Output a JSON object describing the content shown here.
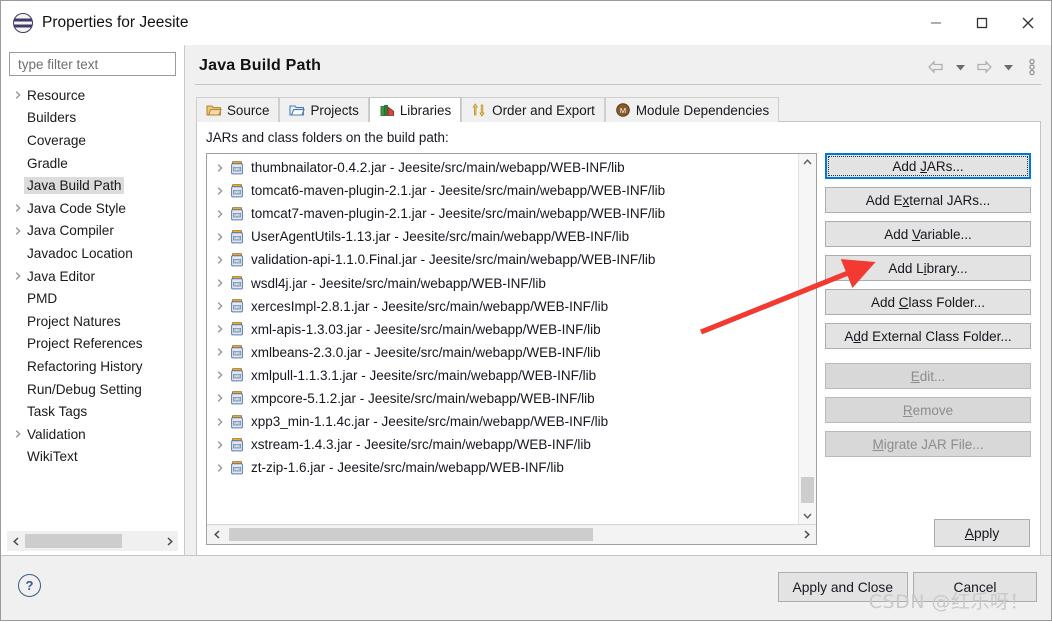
{
  "window": {
    "title": "Properties for Jeesite",
    "icon": "eclipse-icon",
    "controls": {
      "minimize": "minimize-icon",
      "maximize": "maximize-icon",
      "close": "close-icon"
    }
  },
  "sidebar": {
    "filter": {
      "placeholder": "type filter text",
      "value": ""
    },
    "items": [
      {
        "label": "Resource",
        "expandable": true,
        "selected": false
      },
      {
        "label": "Builders",
        "expandable": false,
        "selected": false
      },
      {
        "label": "Coverage",
        "expandable": false,
        "selected": false
      },
      {
        "label": "Gradle",
        "expandable": false,
        "selected": false
      },
      {
        "label": "Java Build Path",
        "expandable": false,
        "selected": true
      },
      {
        "label": "Java Code Style",
        "expandable": true,
        "selected": false
      },
      {
        "label": "Java Compiler",
        "expandable": true,
        "selected": false
      },
      {
        "label": "Javadoc Location",
        "expandable": false,
        "selected": false
      },
      {
        "label": "Java Editor",
        "expandable": true,
        "selected": false
      },
      {
        "label": "PMD",
        "expandable": false,
        "selected": false
      },
      {
        "label": "Project Natures",
        "expandable": false,
        "selected": false
      },
      {
        "label": "Project References",
        "expandable": false,
        "selected": false
      },
      {
        "label": "Refactoring History",
        "expandable": false,
        "selected": false
      },
      {
        "label": "Run/Debug Setting",
        "expandable": false,
        "selected": false
      },
      {
        "label": "Task Tags",
        "expandable": false,
        "selected": false
      },
      {
        "label": "Validation",
        "expandable": true,
        "selected": false
      },
      {
        "label": "WikiText",
        "expandable": false,
        "selected": false
      }
    ]
  },
  "page": {
    "title": "Java Build Path",
    "nav": {
      "back": "back-arrow-icon",
      "forward": "forward-arrow-icon",
      "menu": "view-menu-icon"
    },
    "tabs": [
      {
        "label": "Source",
        "icon": "source-folder-icon",
        "active": false
      },
      {
        "label": "Projects",
        "icon": "projects-folder-icon",
        "active": false
      },
      {
        "label": "Libraries",
        "icon": "libraries-books-icon",
        "active": true
      },
      {
        "label": "Order and Export",
        "icon": "order-export-arrows-icon",
        "active": false
      },
      {
        "label": "Module Dependencies",
        "icon": "module-dependencies-icon",
        "active": false
      }
    ],
    "list_label": "JARs and class folders on the build path:",
    "entries": [
      "thumbnailator-0.4.2.jar - Jeesite/src/main/webapp/WEB-INF/lib",
      "tomcat6-maven-plugin-2.1.jar - Jeesite/src/main/webapp/WEB-INF/lib",
      "tomcat7-maven-plugin-2.1.jar - Jeesite/src/main/webapp/WEB-INF/lib",
      "UserAgentUtils-1.13.jar - Jeesite/src/main/webapp/WEB-INF/lib",
      "validation-api-1.1.0.Final.jar - Jeesite/src/main/webapp/WEB-INF/lib",
      "wsdl4j.jar - Jeesite/src/main/webapp/WEB-INF/lib",
      "xercesImpl-2.8.1.jar - Jeesite/src/main/webapp/WEB-INF/lib",
      "xml-apis-1.3.03.jar - Jeesite/src/main/webapp/WEB-INF/lib",
      "xmlbeans-2.3.0.jar - Jeesite/src/main/webapp/WEB-INF/lib",
      "xmlpull-1.1.3.1.jar - Jeesite/src/main/webapp/WEB-INF/lib",
      "xmpcore-5.1.2.jar - Jeesite/src/main/webapp/WEB-INF/lib",
      "xpp3_min-1.1.4c.jar - Jeesite/src/main/webapp/WEB-INF/lib",
      "xstream-1.4.3.jar - Jeesite/src/main/webapp/WEB-INF/lib",
      "zt-zip-1.6.jar - Jeesite/src/main/webapp/WEB-INF/lib"
    ],
    "buttons": [
      {
        "label": "Add JARs...",
        "mnemonic": "J",
        "disabled": false,
        "focused": true
      },
      {
        "label": "Add External JARs...",
        "mnemonic": "x",
        "disabled": false,
        "focused": false
      },
      {
        "label": "Add Variable...",
        "mnemonic": "V",
        "disabled": false,
        "focused": false
      },
      {
        "label": "Add Library...",
        "mnemonic": "i",
        "disabled": false,
        "focused": false
      },
      {
        "label": "Add Class Folder...",
        "mnemonic": "C",
        "disabled": false,
        "focused": false
      },
      {
        "label": "Add External Class Folder...",
        "mnemonic": "d",
        "disabled": false,
        "focused": false
      },
      {
        "label": "Edit...",
        "mnemonic": "E",
        "disabled": true,
        "focused": false
      },
      {
        "label": "Remove",
        "mnemonic": "R",
        "disabled": true,
        "focused": false
      },
      {
        "label": "Migrate JAR File...",
        "mnemonic": "M",
        "disabled": true,
        "focused": false
      }
    ],
    "apply_label": "Apply"
  },
  "footer": {
    "help_icon": "help-icon",
    "help_glyph": "?",
    "apply_and_close_label": "Apply and Close",
    "cancel_label": "Cancel"
  },
  "annotation": {
    "arrow": "red-arrow-pointing-to-add-library",
    "color": "#f23a33"
  },
  "watermark": {
    "text": "CSDN @红乐呀！"
  }
}
